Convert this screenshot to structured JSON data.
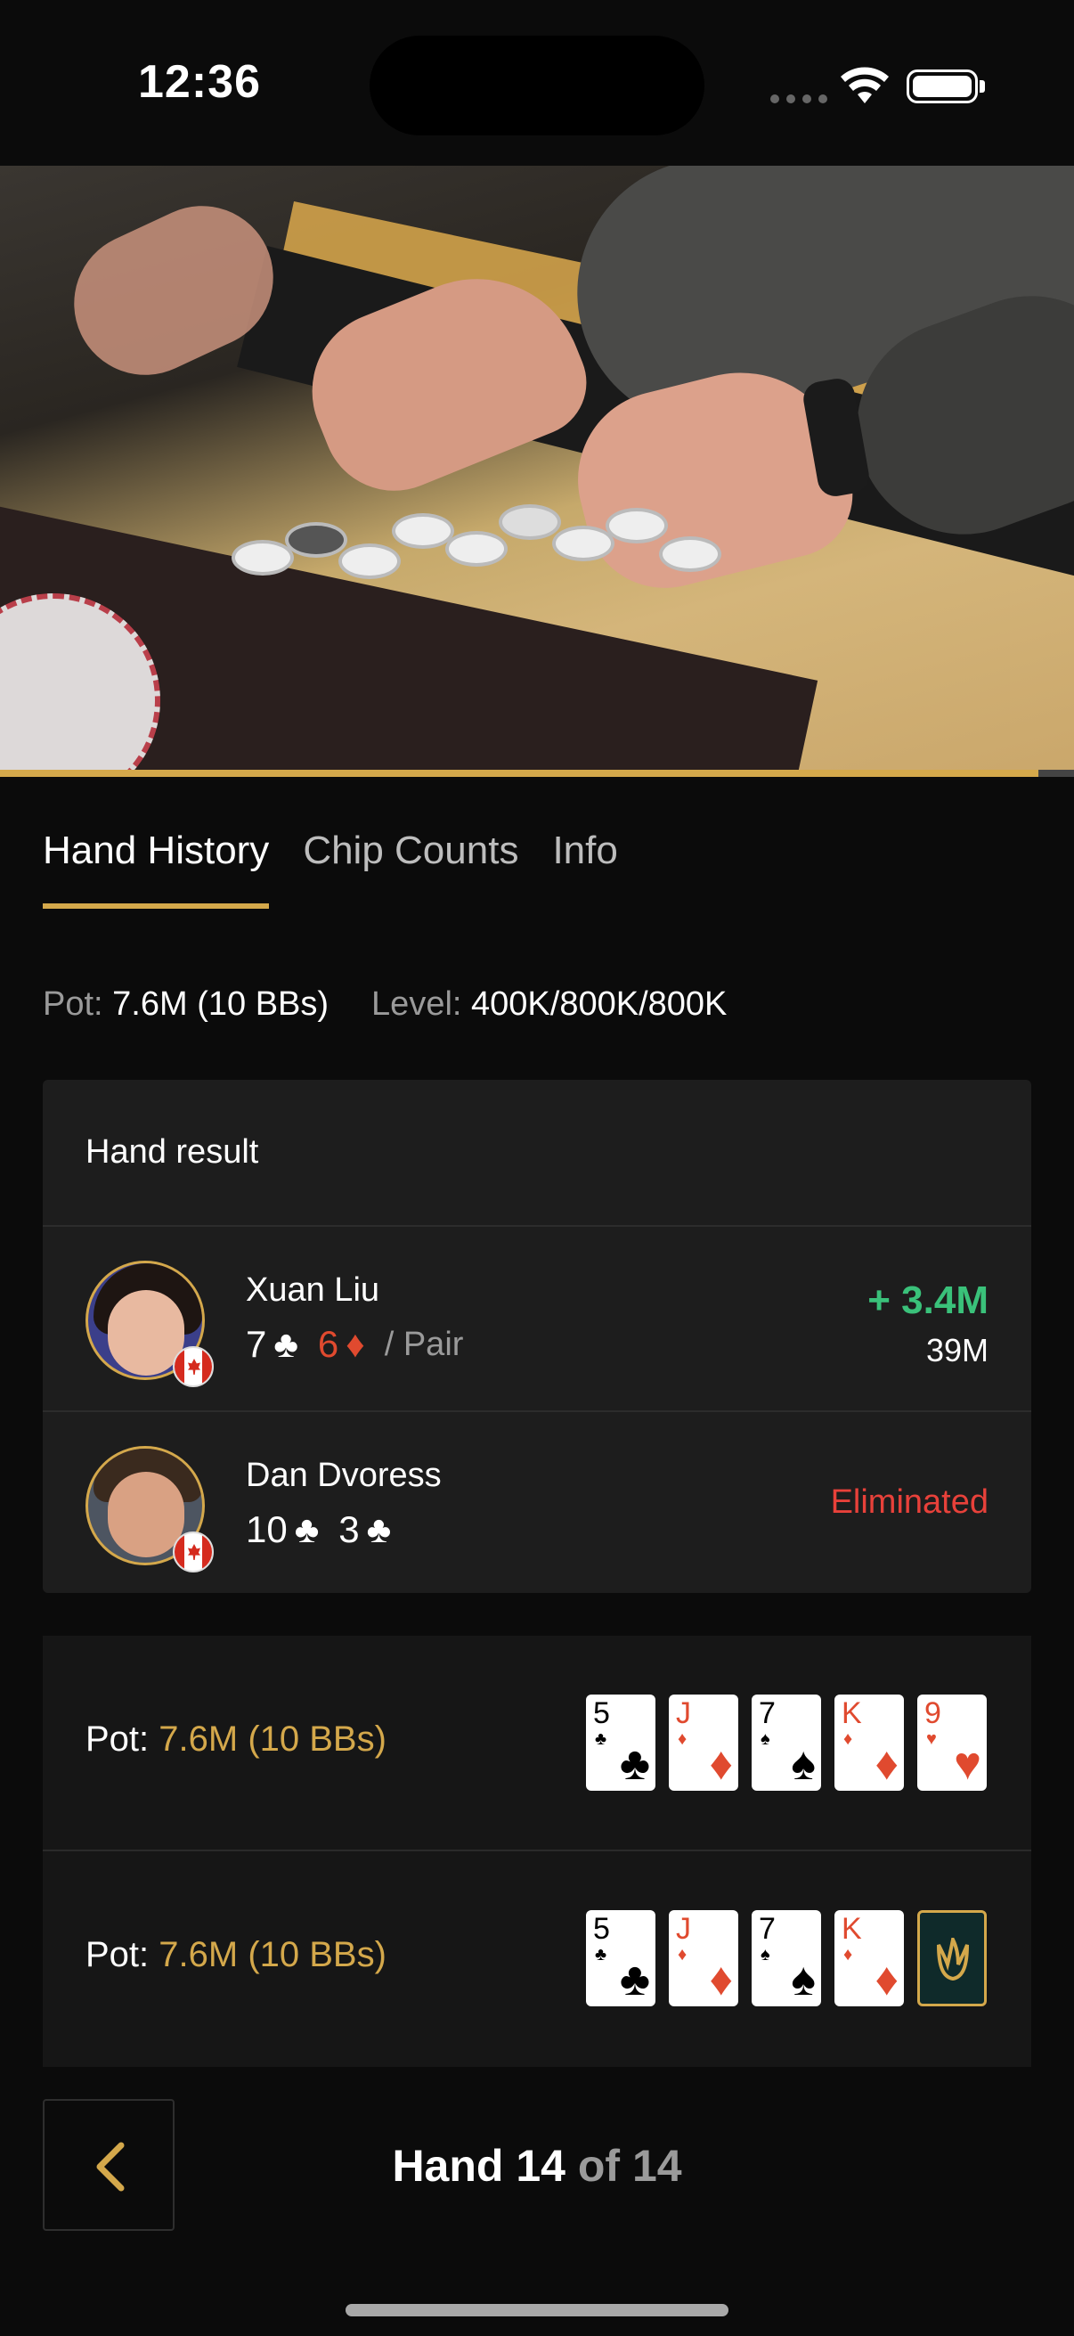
{
  "status": {
    "time": "12:36"
  },
  "tabs": [
    {
      "label": "Hand History",
      "active": true
    },
    {
      "label": "Chip Counts",
      "active": false
    },
    {
      "label": "Info",
      "active": false
    }
  ],
  "meta": {
    "pot_label": "Pot:",
    "pot_value": "7.6M (10 BBs)",
    "level_label": "Level:",
    "level_value": "400K/800K/800K"
  },
  "result": {
    "title": "Hand result",
    "players": [
      {
        "name": "Xuan Liu",
        "card1_rank": "7",
        "card1_suit": "♣",
        "card2_rank": "6",
        "card2_suit": "♦",
        "hand_desc": "/ Pair",
        "winnings": "+ 3.4M",
        "stack": "39M"
      },
      {
        "name": "Dan Dvoress",
        "card1_rank": "10",
        "card1_suit": "♣",
        "card2_rank": "3",
        "card2_suit": "♣",
        "status": "Eliminated"
      }
    ]
  },
  "boards": [
    {
      "pot_label": "Pot:",
      "pot_value": "7.6M (10 BBs)",
      "cards": [
        {
          "rank": "5",
          "suit": "♣",
          "color": "black"
        },
        {
          "rank": "J",
          "suit": "♦",
          "color": "red"
        },
        {
          "rank": "7",
          "suit": "♠",
          "color": "black"
        },
        {
          "rank": "K",
          "suit": "♦",
          "color": "red"
        },
        {
          "rank": "9",
          "suit": "♥",
          "color": "red"
        }
      ]
    },
    {
      "pot_label": "Pot:",
      "pot_value": "7.6M (10 BBs)",
      "cards": [
        {
          "rank": "5",
          "suit": "♣",
          "color": "black"
        },
        {
          "rank": "J",
          "suit": "♦",
          "color": "red"
        },
        {
          "rank": "7",
          "suit": "♠",
          "color": "black"
        },
        {
          "rank": "K",
          "suit": "♦",
          "color": "red"
        },
        {
          "rank": "",
          "suit": "",
          "color": "back"
        }
      ]
    }
  ],
  "nav": {
    "hand_label": "Hand 14",
    "of_label": "of 14"
  },
  "colors": {
    "accent_gold": "#d4a84b",
    "win_green": "#3ac17a",
    "loss_red": "#e8413a",
    "diamond_red": "#e04a2f"
  },
  "icons": {
    "back": "chevron-left-icon",
    "card_back": "flame-logo-icon"
  }
}
